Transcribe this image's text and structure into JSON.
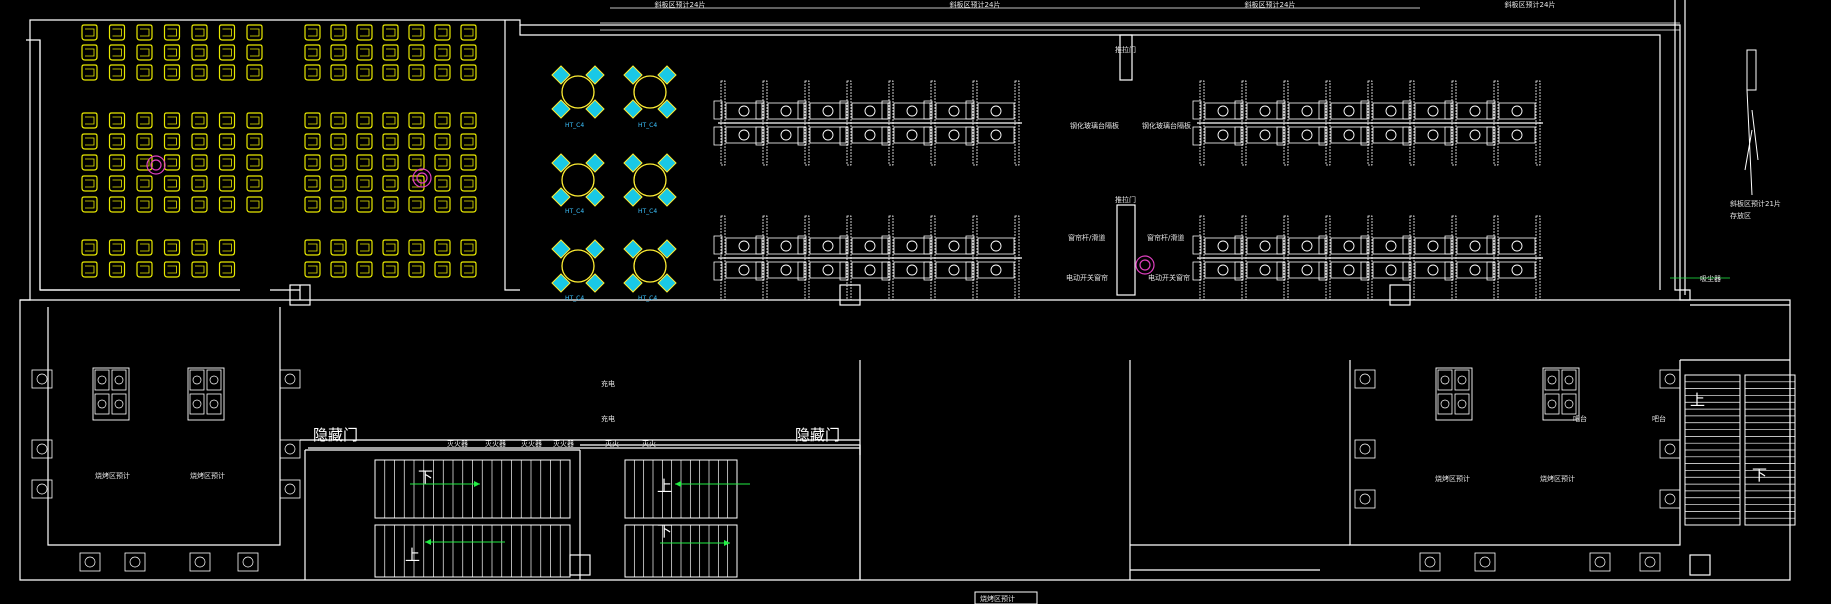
{
  "plan": {
    "colors": {
      "background": "#000000",
      "wall": "#ffffff",
      "seat": "#e8e800",
      "round_table": "#ffee33",
      "chair_cyan": "#19c8e6",
      "fan": "#e040c0",
      "arrow": "#22ee44",
      "label_cyan": "#3cc3ff"
    },
    "top_labels": [
      "斜板区预计24片",
      "斜板区预计24片",
      "斜板区预计24片",
      "斜板区预计24片"
    ],
    "door_labels": [
      "推拉门",
      "推拉门"
    ],
    "desk_side_labels": [
      "钢化玻璃台隔板",
      "钢化玻璃台隔板",
      "窗帘杆/滑道",
      "窗帘杆/滑道",
      "电动开关窗帘",
      "电动开关窗帘"
    ],
    "table_tags": [
      "HT_C4",
      "HT_C4",
      "HT_C4",
      "HT_C4",
      "HT_C4",
      "HT_C4"
    ],
    "right_side_label_1": "斜板区预计21片",
    "right_side_label_2": "存放区",
    "right_side_label_3": "吸尘器",
    "hidden_door_labels": [
      "隐藏门",
      "隐藏门"
    ],
    "corridor_labels": [
      "灭火器",
      "灭火器",
      "灭火器",
      "灭火器",
      "灭火",
      "灭火"
    ],
    "small_labels": [
      "充电",
      "充电",
      "吧台",
      "吧台"
    ],
    "stair_labels": [
      "下",
      "上",
      "上",
      "下",
      "上",
      "下"
    ],
    "stove_labels": [
      "烧烤区预计",
      "烧烤区预计",
      "烧烤区预计",
      "烧烤区预计"
    ],
    "bottom_title": "烧烤区预计"
  }
}
